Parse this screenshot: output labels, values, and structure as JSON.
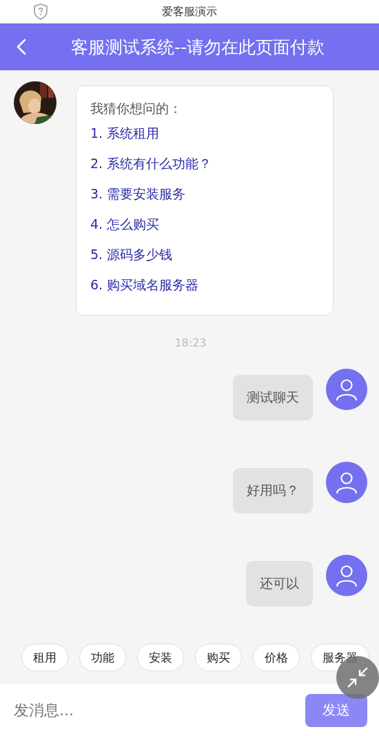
{
  "status_bar": {
    "title": "爱客服演示"
  },
  "header": {
    "title": "客服测试系统--请勿在此页面付款"
  },
  "messages": [
    {
      "kind": "agent",
      "intro": "我猜你想问的：",
      "options": [
        "1. 系统租用",
        "2. 系统有什么功能？",
        "3. 需要安装服务",
        "4. 怎么购买",
        "5. 源码多少钱",
        "6. 购买域名服务器"
      ]
    },
    {
      "kind": "time",
      "text": "18:23"
    },
    {
      "kind": "user",
      "text": "测试聊天"
    },
    {
      "kind": "user",
      "text": "好用吗？"
    },
    {
      "kind": "user",
      "text": "还可以"
    }
  ],
  "quick_replies": [
    "租用",
    "功能",
    "安装",
    "购买",
    "价格",
    "服务器"
  ],
  "composer": {
    "placeholder": "发消息...",
    "send": "发送"
  }
}
